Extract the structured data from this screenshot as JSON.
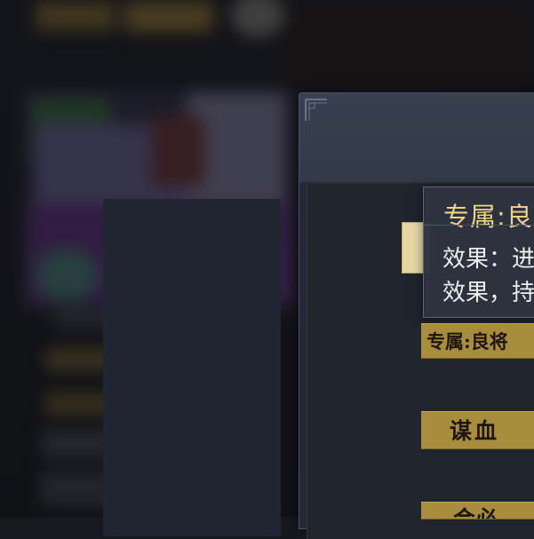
{
  "tooltip": {
    "title": "专属:良",
    "effect_line_1": "效果：进",
    "effect_line_2": "效果，持"
  },
  "skills": [
    {
      "label": "专属:良将"
    },
    {
      "label": "谋血"
    },
    {
      "label": "会必"
    }
  ],
  "colors": {
    "tooltip_title": "#f0d38a",
    "skill_tag_bg": "#a88e3c",
    "panel_bg": "#242a34",
    "panel_header": "#38404f",
    "selected_tab": "#e4d7a4"
  }
}
